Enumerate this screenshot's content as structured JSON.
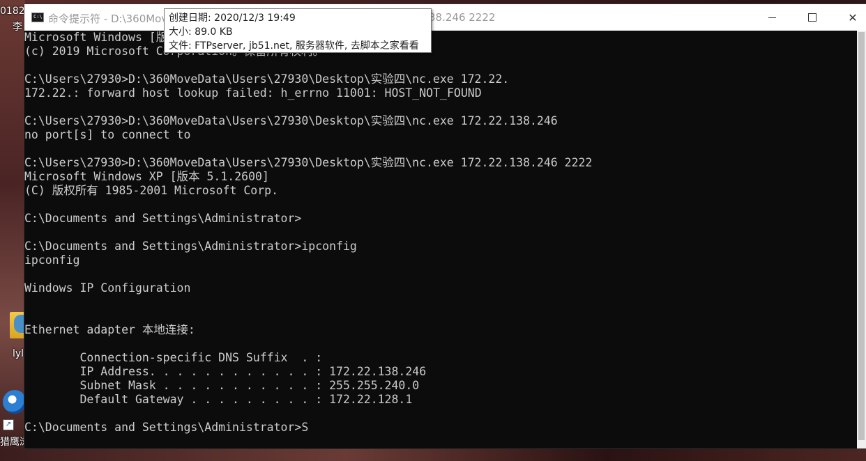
{
  "desktop": {
    "text_top": "0182",
    "text_li": "李",
    "folder_label": "lyl",
    "browser_label": "猎鹰浏"
  },
  "window": {
    "title_left": "命令提示符 - D:\\360Move",
    "title_right": "38.246 2222",
    "icon_label": "C:\\",
    "minimize_icon": "minimize-icon",
    "maximize_icon": "maximize-icon",
    "close_glyph": "✕"
  },
  "tooltip": {
    "created": "创建日期: 2020/12/3 19:49",
    "size": "大小: 89.0 KB",
    "files": "文件: FTPserver, jb51.net, 服务器软件, 去脚本之家看看"
  },
  "console": {
    "lines": [
      "Microsoft Windows [版",
      "(c) 2019 Microsoft Corporation。保留所有权利。",
      "",
      "C:\\Users\\27930>D:\\360MoveData\\Users\\27930\\Desktop\\实验四\\nc.exe 172.22.",
      "172.22.: forward host lookup failed: h_errno 11001: HOST_NOT_FOUND",
      "",
      "C:\\Users\\27930>D:\\360MoveData\\Users\\27930\\Desktop\\实验四\\nc.exe 172.22.138.246",
      "no port[s] to connect to",
      "",
      "C:\\Users\\27930>D:\\360MoveData\\Users\\27930\\Desktop\\实验四\\nc.exe 172.22.138.246 2222",
      "Microsoft Windows XP [版本 5.1.2600]",
      "(C) 版权所有 1985-2001 Microsoft Corp.",
      "",
      "C:\\Documents and Settings\\Administrator>",
      "",
      "C:\\Documents and Settings\\Administrator>ipconfig",
      "ipconfig",
      "",
      "Windows IP Configuration",
      "",
      "",
      "Ethernet adapter 本地连接:",
      "",
      "        Connection-specific DNS Suffix  . :",
      "        IP Address. . . . . . . . . . . . : 172.22.138.246",
      "        Subnet Mask . . . . . . . . . . . : 255.255.240.0",
      "        Default Gateway . . . . . . . . . : 172.22.128.1",
      "",
      "C:\\Documents and Settings\\Administrator>S"
    ]
  }
}
